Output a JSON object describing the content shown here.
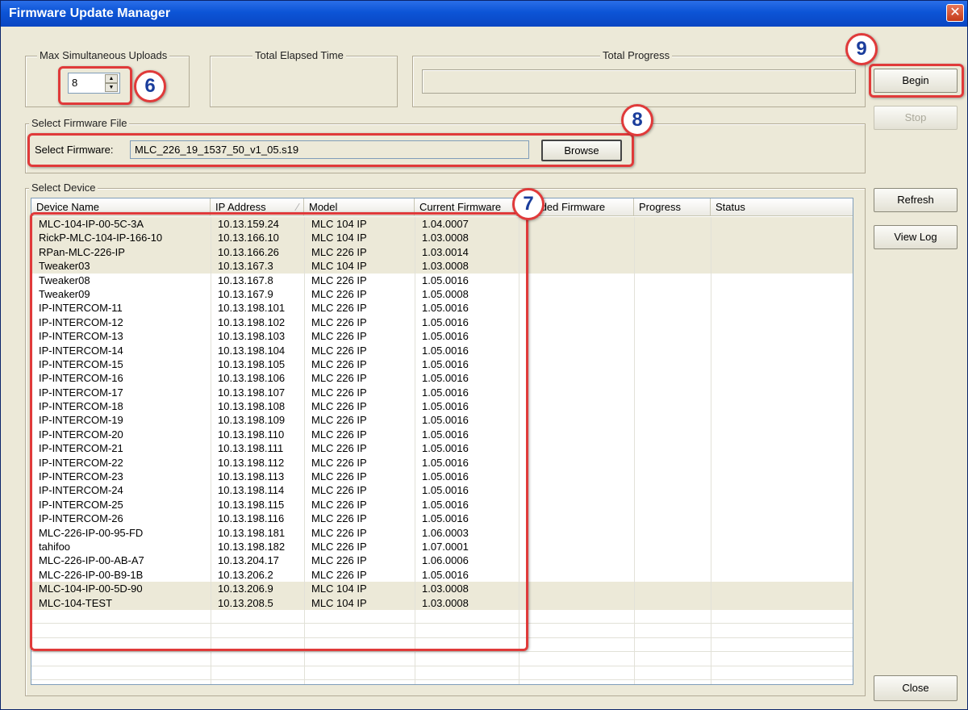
{
  "window": {
    "title": "Firmware Update Manager",
    "close_glyph": "✕"
  },
  "groups": {
    "max_uploads": {
      "legend": "Max Simultaneous Uploads",
      "value": "8"
    },
    "elapsed": {
      "legend": "Total Elapsed Time"
    },
    "progress": {
      "legend": "Total Progress"
    },
    "firmware": {
      "legend": "Select Firmware File",
      "label": "Select Firmware:",
      "value": "MLC_226_19_1537_50_v1_05.s19",
      "browse_label": "Browse"
    },
    "device": {
      "legend": "Select Device"
    }
  },
  "buttons": {
    "begin": "Begin",
    "stop": "Stop",
    "refresh": "Refresh",
    "view_log": "View Log",
    "close": "Close"
  },
  "table": {
    "headers": [
      "Device Name",
      "IP Address",
      "Model",
      "Current Firmware",
      "Loaded Firmware",
      "Progress",
      "Status"
    ],
    "rows": [
      [
        "MLC-104-IP-00-5C-3A",
        "10.13.159.24",
        "MLC 104 IP",
        "1.04.0007"
      ],
      [
        "RickP-MLC-104-IP-166-10",
        "10.13.166.10",
        "MLC 104 IP",
        "1.03.0008"
      ],
      [
        "RPan-MLC-226-IP",
        "10.13.166.26",
        "MLC 226 IP",
        "1.03.0014"
      ],
      [
        "Tweaker03",
        "10.13.167.3",
        "MLC 104 IP",
        "1.03.0008"
      ],
      [
        "Tweaker08",
        "10.13.167.8",
        "MLC 226 IP",
        "1.05.0016"
      ],
      [
        "Tweaker09",
        "10.13.167.9",
        "MLC 226 IP",
        "1.05.0008"
      ],
      [
        "IP-INTERCOM-11",
        "10.13.198.101",
        "MLC 226 IP",
        "1.05.0016"
      ],
      [
        "IP-INTERCOM-12",
        "10.13.198.102",
        "MLC 226 IP",
        "1.05.0016"
      ],
      [
        "IP-INTERCOM-13",
        "10.13.198.103",
        "MLC 226 IP",
        "1.05.0016"
      ],
      [
        "IP-INTERCOM-14",
        "10.13.198.104",
        "MLC 226 IP",
        "1.05.0016"
      ],
      [
        "IP-INTERCOM-15",
        "10.13.198.105",
        "MLC 226 IP",
        "1.05.0016"
      ],
      [
        "IP-INTERCOM-16",
        "10.13.198.106",
        "MLC 226 IP",
        "1.05.0016"
      ],
      [
        "IP-INTERCOM-17",
        "10.13.198.107",
        "MLC 226 IP",
        "1.05.0016"
      ],
      [
        "IP-INTERCOM-18",
        "10.13.198.108",
        "MLC 226 IP",
        "1.05.0016"
      ],
      [
        "IP-INTERCOM-19",
        "10.13.198.109",
        "MLC 226 IP",
        "1.05.0016"
      ],
      [
        "IP-INTERCOM-20",
        "10.13.198.110",
        "MLC 226 IP",
        "1.05.0016"
      ],
      [
        "IP-INTERCOM-21",
        "10.13.198.111",
        "MLC 226 IP",
        "1.05.0016"
      ],
      [
        "IP-INTERCOM-22",
        "10.13.198.112",
        "MLC 226 IP",
        "1.05.0016"
      ],
      [
        "IP-INTERCOM-23",
        "10.13.198.113",
        "MLC 226 IP",
        "1.05.0016"
      ],
      [
        "IP-INTERCOM-24",
        "10.13.198.114",
        "MLC 226 IP",
        "1.05.0016"
      ],
      [
        "IP-INTERCOM-25",
        "10.13.198.115",
        "MLC 226 IP",
        "1.05.0016"
      ],
      [
        "IP-INTERCOM-26",
        "10.13.198.116",
        "MLC 226 IP",
        "1.05.0016"
      ],
      [
        "MLC-226-IP-00-95-FD",
        "10.13.198.181",
        "MLC 226 IP",
        "1.06.0003"
      ],
      [
        "tahifoo",
        "10.13.198.182",
        "MLC 226 IP",
        "1.07.0001"
      ],
      [
        "MLC-226-IP-00-AB-A7",
        "10.13.204.17",
        "MLC 226 IP",
        "1.06.0006"
      ],
      [
        "MLC-226-IP-00-B9-1B",
        "10.13.206.2",
        "MLC 226 IP",
        "1.05.0016"
      ],
      [
        "MLC-104-IP-00-5D-90",
        "10.13.206.9",
        "MLC 104 IP",
        "1.03.0008"
      ],
      [
        "MLC-104-TEST",
        "10.13.208.5",
        "MLC 104 IP",
        "1.03.0008"
      ]
    ],
    "shaded_rows": [
      0,
      1,
      2,
      3,
      26,
      27
    ]
  },
  "callouts": [
    "6",
    "7",
    "8",
    "9"
  ],
  "colors": {
    "callout_border": "#e03a3a",
    "callout_text": "#1a3d9c",
    "titlebar": "#0c54d6"
  }
}
